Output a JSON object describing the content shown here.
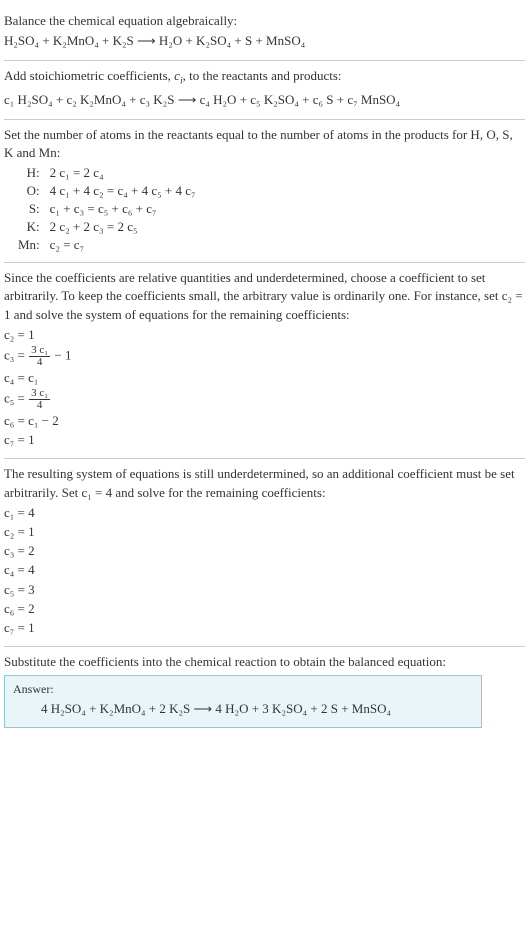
{
  "s1": {
    "line1": "Balance the chemical equation algebraically:",
    "eq": "H₂SO₄ + K₂MnO₄ + K₂S ⟶ H₂O + K₂SO₄ + S + MnSO₄"
  },
  "s2": {
    "line1_a": "Add stoichiometric coefficients, ",
    "line1_b": "c",
    "line1_c": "i",
    "line1_d": ", to the reactants and products:",
    "eq": "c₁ H₂SO₄ + c₂ K₂MnO₄ + c₃ K₂S ⟶ c₄ H₂O + c₅ K₂SO₄ + c₆ S + c₇ MnSO₄"
  },
  "s3": {
    "line1": "Set the number of atoms in the reactants equal to the number of atoms in the products for H, O, S, K and Mn:",
    "rows": [
      {
        "lbl": "H:",
        "eq": "2 c₁ = 2 c₄"
      },
      {
        "lbl": "O:",
        "eq": "4 c₁ + 4 c₂ = c₄ + 4 c₅ + 4 c₇"
      },
      {
        "lbl": "S:",
        "eq": "c₁ + c₃ = c₅ + c₆ + c₇"
      },
      {
        "lbl": "K:",
        "eq": "2 c₂ + 2 c₃ = 2 c₅"
      },
      {
        "lbl": "Mn:",
        "eq": "c₂ = c₇"
      }
    ]
  },
  "s4": {
    "line1": "Since the coefficients are relative quantities and underdetermined, choose a coefficient to set arbitrarily. To keep the coefficients small, the arbitrary value is ordinarily one. For instance, set c₂ = 1 and solve the system of equations for the remaining coefficients:",
    "c2": "c₂ = 1",
    "c3_lhs": "c₃ = ",
    "c3_num": "3 c₁",
    "c3_den": "4",
    "c3_tail": " − 1",
    "c4": "c₄ = c₁",
    "c5_lhs": "c₅ = ",
    "c5_num": "3 c₁",
    "c5_den": "4",
    "c6": "c₆ = c₁ − 2",
    "c7": "c₇ = 1"
  },
  "s5": {
    "line1": "The resulting system of equations is still underdetermined, so an additional coefficient must be set arbitrarily. Set c₁ = 4 and solve for the remaining coefficients:",
    "coeffs": [
      "c₁ = 4",
      "c₂ = 1",
      "c₃ = 2",
      "c₄ = 4",
      "c₅ = 3",
      "c₆ = 2",
      "c₇ = 1"
    ]
  },
  "s6": {
    "line1": "Substitute the coefficients into the chemical reaction to obtain the balanced equation:",
    "answer_label": "Answer:",
    "answer_eq": "4 H₂SO₄ + K₂MnO₄ + 2 K₂S ⟶ 4 H₂O + 3 K₂SO₄ + 2 S + MnSO₄"
  }
}
